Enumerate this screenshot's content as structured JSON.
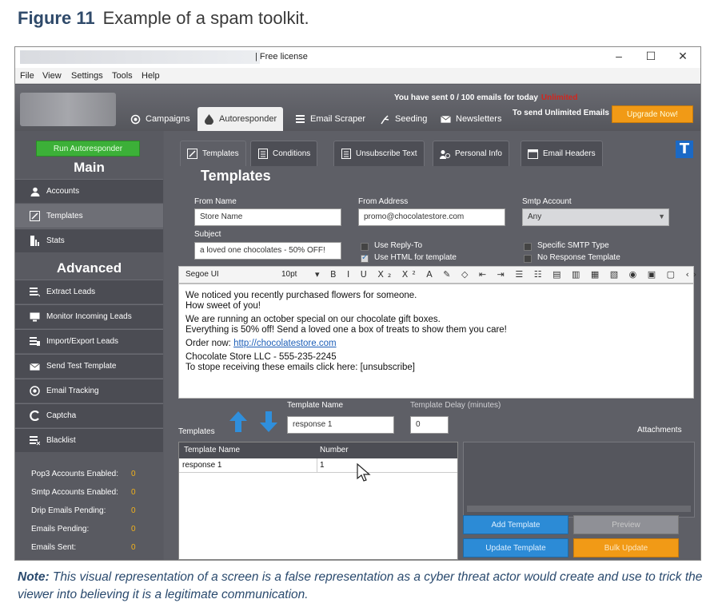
{
  "figure": {
    "label": "Figure 11",
    "caption": "Example of a spam toolkit."
  },
  "window": {
    "title": "| Free license",
    "controls": [
      "–",
      "☐",
      "✕"
    ]
  },
  "menu": [
    "File",
    "View",
    "Settings",
    "Tools",
    "Help"
  ],
  "header": {
    "sent_message": "You have sent 0 / 100 emails for today",
    "sent_suffix": "Unlimited",
    "tabs": [
      {
        "label": "Campaigns",
        "icon": "campaigns-icon"
      },
      {
        "label": "Autoresponder",
        "icon": "drop-icon",
        "active": true
      },
      {
        "label": "Email Scraper",
        "icon": "scraper-icon"
      },
      {
        "label": "Seeding",
        "icon": "seeding-icon"
      },
      {
        "label": "Newsletters",
        "icon": "newsletter-icon"
      }
    ],
    "unlimited_text": "To send Unlimited Emails",
    "upgrade_label": "Upgrade Now!"
  },
  "sidebar": {
    "run_button": "Run Autoresponder",
    "main_heading": "Main",
    "main_items": [
      {
        "label": "Accounts",
        "icon": "user-icon"
      },
      {
        "label": "Templates",
        "icon": "template-icon",
        "selected": true
      },
      {
        "label": "Stats",
        "icon": "stats-icon"
      }
    ],
    "advanced_heading": "Advanced",
    "advanced_items": [
      {
        "label": "Extract Leads",
        "icon": "extract-icon"
      },
      {
        "label": "Monitor Incoming Leads",
        "icon": "monitor-icon"
      },
      {
        "label": "Import/Export Leads",
        "icon": "import-icon"
      },
      {
        "label": "Send Test Template",
        "icon": "send-icon"
      },
      {
        "label": "Email Tracking",
        "icon": "tracking-icon"
      },
      {
        "label": "Captcha",
        "icon": "captcha-icon"
      },
      {
        "label": "Blacklist",
        "icon": "blacklist-icon"
      }
    ],
    "stats": [
      {
        "label": "Pop3 Accounts Enabled:",
        "value": "0"
      },
      {
        "label": "Smtp Accounts Enabled:",
        "value": "0"
      },
      {
        "label": "Drip Emails Pending:",
        "value": "0"
      },
      {
        "label": "Emails Pending:",
        "value": "0"
      },
      {
        "label": "Emails Sent:",
        "value": "0"
      }
    ]
  },
  "subtabs": [
    {
      "label": "Templates",
      "icon": "edit-icon",
      "active": true
    },
    {
      "label": "Conditions",
      "icon": "conditions-icon"
    },
    {
      "label": "Unsubscribe Text",
      "icon": "unsubscribe-icon"
    },
    {
      "label": "Personal Info",
      "icon": "personal-icon"
    },
    {
      "label": "Email Headers",
      "icon": "headers-icon"
    }
  ],
  "templates": {
    "title": "Templates",
    "from_name_label": "From Name",
    "from_name_value": "Store Name",
    "from_address_label": "From Address",
    "from_address_value": "promo@chocolatestore.com",
    "smtp_label": "Smtp Account",
    "smtp_value": "Any",
    "subject_label": "Subject",
    "subject_value": "a loved one chocolates - 50% OFF!",
    "use_reply_to": "Use Reply-To",
    "use_html": "Use HTML for template",
    "specific_smtp": "Specific SMTP Type",
    "no_response": "No Response Template",
    "font": "Segoe UI",
    "font_size": "10pt",
    "body": [
      "We noticed you recently purchased flowers for someone.",
      "How sweet of you!",
      "We are running an october special on our chocolate gift boxes.",
      "Everything is 50% off! Send a loved one a box of treats to show them you care!",
      "Order now:",
      "http://chocolatestore.com",
      "Chocolate Store LLC - 555-235-2245",
      "To stope receiving these emails click here: [unsubscribe]"
    ],
    "template_name_label": "Template Name",
    "template_name_value": "response 1",
    "template_delay_label": "Template Delay (minutes)",
    "template_delay_value": "0",
    "templates_label": "Templates",
    "attachments_label": "Attachments",
    "grid_headers": [
      "Template Name",
      "Number"
    ],
    "grid_rows": [
      [
        "response 1",
        "1"
      ]
    ],
    "add_button": "Add Template",
    "preview_button": "Preview",
    "update_button": "Update Template",
    "bulk_button": "Bulk Update"
  },
  "note": {
    "prefix": "Note:",
    "text": "This visual representation of a  screen is a false representation as a cyber threat actor would create and use to trick the viewer into believing it is a legitimate communication."
  }
}
